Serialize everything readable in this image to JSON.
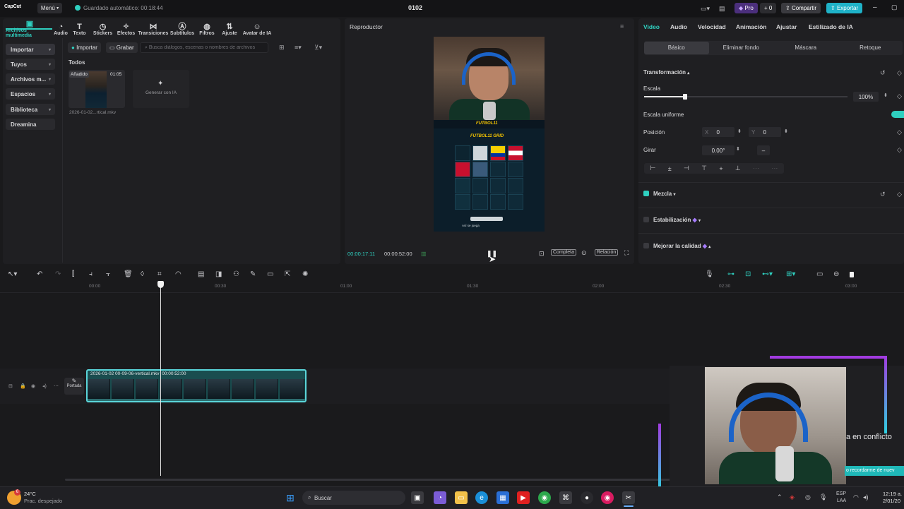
{
  "app": {
    "logo": "CapCut",
    "menu_label": "Menú",
    "autosave": "Guardado automático: 00:18:44",
    "project_title": "0102",
    "pro_label": "Pro",
    "credits_label": "0",
    "share_label": "Compartir",
    "export_label": "Exportar"
  },
  "media_toolbar": [
    {
      "icon": "media-icon",
      "label": "Archivos multimedia",
      "active": true
    },
    {
      "icon": "audio-icon",
      "label": "Audio"
    },
    {
      "icon": "text-icon",
      "label": "Texto"
    },
    {
      "icon": "stickers-icon",
      "label": "Stickers"
    },
    {
      "icon": "effects-icon",
      "label": "Efectos"
    },
    {
      "icon": "transitions-icon",
      "label": "Transiciones"
    },
    {
      "icon": "subtitles-icon",
      "label": "Subtítulos"
    },
    {
      "icon": "filters-icon",
      "label": "Filtros"
    },
    {
      "icon": "adjust-icon",
      "label": "Ajuste"
    },
    {
      "icon": "ai-avatar-icon",
      "label": "Avatar de IA"
    }
  ],
  "sidebar": [
    {
      "label": "Importar",
      "active": true
    },
    {
      "label": "Tuyos"
    },
    {
      "label": "Archivos m..."
    },
    {
      "label": "Espacios"
    },
    {
      "label": "Biblioteca"
    },
    {
      "label": "Dreamina"
    }
  ],
  "media": {
    "import_label": "Importar",
    "record_label": "Grabar",
    "search_placeholder": "Busca diálogos, escenas o nombres de archivos",
    "section_title": "Todos",
    "clip_badge": "Añadido",
    "clip_duration": "01:05",
    "clip_name": "2026-01-02...rtical.mkv",
    "generate_label": "Generar con IA"
  },
  "player": {
    "title": "Reproductor",
    "current_time": "00:00:17:11",
    "total_time": "00:00:52:00",
    "full_label": "Completa",
    "ratio_label": "Relación",
    "game_title": "FUTBOL11 GRID",
    "brand": "FUTBOL11",
    "caption": "Así se juega"
  },
  "props": {
    "tabs": [
      "Video",
      "Audio",
      "Velocidad",
      "Animación",
      "Ajustar",
      "Estilizado de IA"
    ],
    "subtabs": [
      "Básico",
      "Eliminar fondo",
      "Máscara",
      "Retoque"
    ],
    "transform_label": "Transformación",
    "scale_label": "Escala",
    "scale_value": 100,
    "scale_text": "100%",
    "uniform_label": "Escala uniforme",
    "position_label": "Posición",
    "pos_x_label": "X",
    "pos_x": "0",
    "pos_y_label": "Y",
    "pos_y": "0",
    "rotate_label": "Girar",
    "rotate_value": "0.00°",
    "blend_label": "Mezcla",
    "stabilize_label": "Estabilización",
    "enhance_label": "Mejorar la calidad"
  },
  "timeline": {
    "ticks": [
      "00:00",
      "00:30",
      "01:00",
      "01:30",
      "02:00",
      "02:30",
      "03:00"
    ],
    "clip_name": "2026-01-02 00-09-06-vertical.mkv",
    "clip_duration": "00:00:52:00",
    "cover_label": "Portada"
  },
  "overlay": {
    "caption": "a en conflicto",
    "ticker": "o recordarme de nuev"
  },
  "taskbar": {
    "weather_temp": "24°C",
    "weather_desc": "Prac. despejado",
    "badge": "6",
    "search_label": "Buscar",
    "lang": "ESP",
    "layout": "LAA",
    "time": "12:19 a.",
    "date": "2/01/20"
  }
}
